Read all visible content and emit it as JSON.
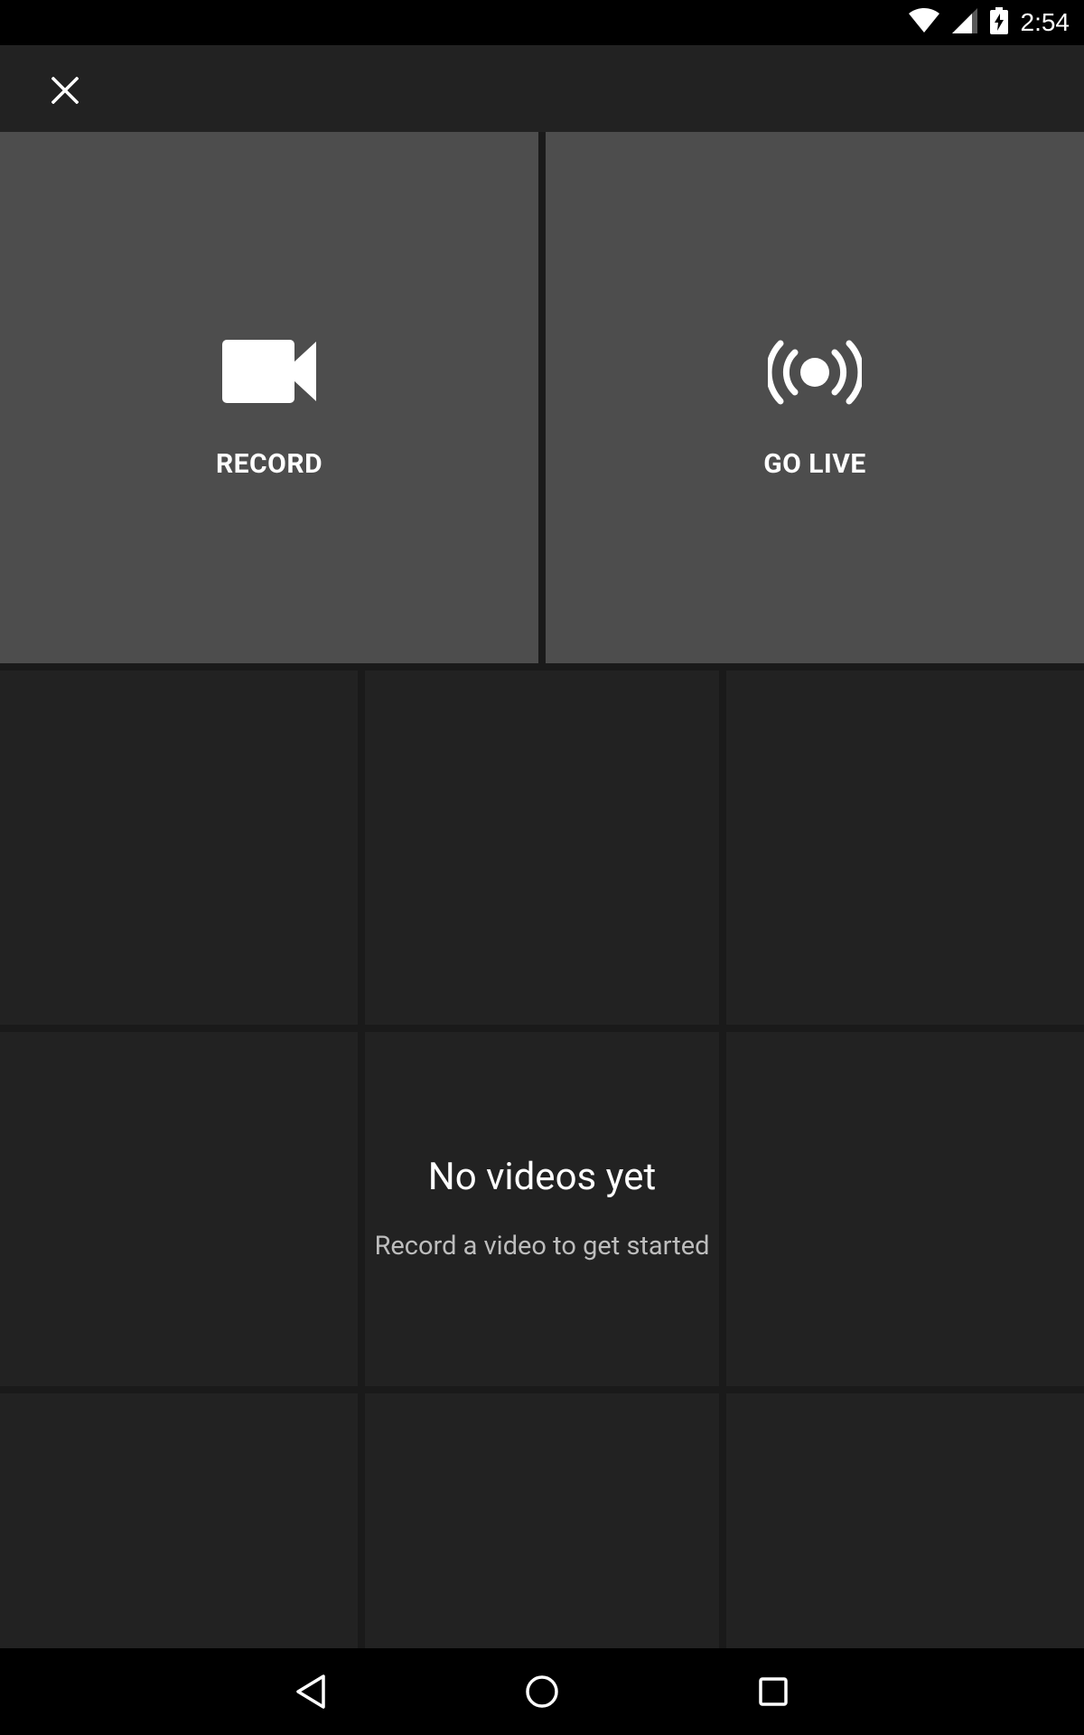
{
  "status_bar": {
    "time": "2:54",
    "icons": [
      "wifi-icon",
      "cell-signal-icon",
      "battery-charging-icon"
    ]
  },
  "app_bar": {
    "close_icon": "close-icon"
  },
  "actions": {
    "record": {
      "label": "RECORD",
      "icon": "videocam-icon"
    },
    "go_live": {
      "label": "GO LIVE",
      "icon": "live-broadcast-icon"
    }
  },
  "empty_state": {
    "title": "No videos yet",
    "subtitle": "Record a video to get started"
  },
  "nav_bar": {
    "buttons": [
      "back-icon",
      "home-icon",
      "recents-icon"
    ]
  },
  "colors": {
    "panel_bg": "#4d4d4d",
    "cell_bg": "#222222",
    "app_bar_bg": "#222222",
    "status_bg": "#000000"
  }
}
